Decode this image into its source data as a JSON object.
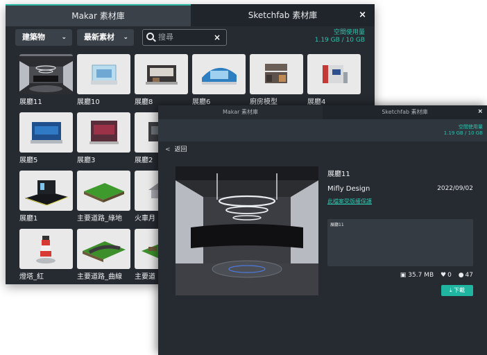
{
  "back_window": {
    "tabs": [
      "Makar 素材庫",
      "Sketchfab 素材庫"
    ],
    "close": "×",
    "category_filter": {
      "value": "建築物"
    },
    "sort_filter": {
      "value": "最新素材"
    },
    "search": {
      "placeholder": "搜尋",
      "clear": "×"
    },
    "quota": {
      "label": "空間使用量",
      "value": "1.19 GB / 10 GB"
    },
    "items": [
      "展廳11",
      "展廳10",
      "展廳8",
      "展廳6",
      "廚房模型",
      "展廳4",
      "展廳5",
      "展廳3",
      "展廳2",
      "展廳1",
      "主要道路_綠地",
      "火車月",
      "燈塔_紅",
      "主要道路_曲線",
      "主要道"
    ]
  },
  "front_window": {
    "tabs": [
      "Makar 素材庫",
      "Sketchfab 素材庫"
    ],
    "close": "×",
    "quota": {
      "label": "空間使用量",
      "value": "1.19 GB / 10 GB"
    },
    "back_label": "返回",
    "detail": {
      "title": "展廳11",
      "author": "Mifly Design",
      "date": "2022/09/02",
      "license": "此檔案受版權保護",
      "description": "展廳11",
      "size": "35.7 MB",
      "likes": "0",
      "views": "47",
      "download_label": "下載"
    }
  },
  "colors": {
    "accent": "#2bc3ad",
    "panel_bg": "#262b31",
    "tab_active": "#3b4149"
  }
}
